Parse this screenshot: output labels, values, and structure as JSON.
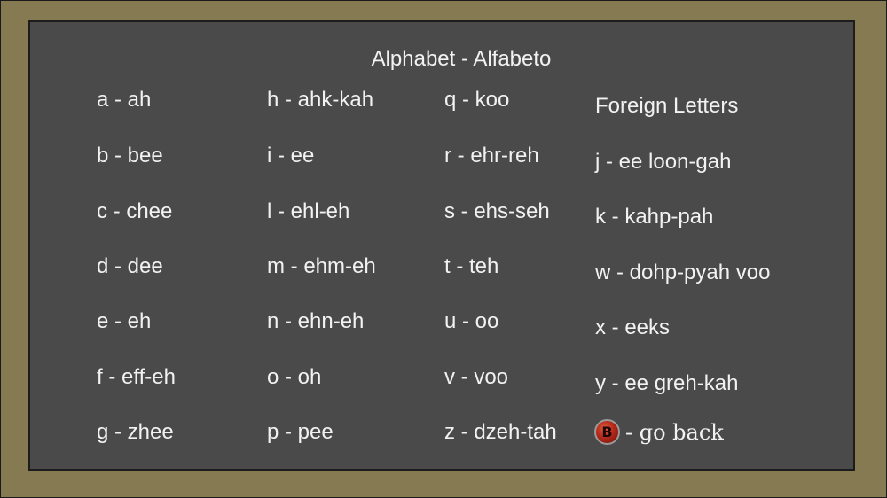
{
  "title": "Alphabet - Alfabeto",
  "columns": [
    [
      "a - ah",
      "b - bee",
      "c - chee",
      "d - dee",
      "e - eh",
      "f - eff-eh",
      "g - zhee"
    ],
    [
      "h - ahk-kah",
      "i - ee",
      "l - ehl-eh",
      "m - ehm-eh",
      "n - ehn-eh",
      "o - oh",
      "p - pee"
    ],
    [
      "q - koo",
      "r - ehr-reh",
      "s - ehs-seh",
      "t - teh",
      "u - oo",
      "v - voo",
      "z - dzeh-tah"
    ]
  ],
  "foreign": {
    "heading": "Foreign Letters",
    "items": [
      "j - ee loon-gah",
      "k - kahp-pah",
      "w - dohp-pyah voo",
      "x - eeks",
      "y - ee greh-kah"
    ]
  },
  "back": {
    "button_glyph": "B",
    "label": "- go back",
    "icon": "b-button-icon"
  }
}
